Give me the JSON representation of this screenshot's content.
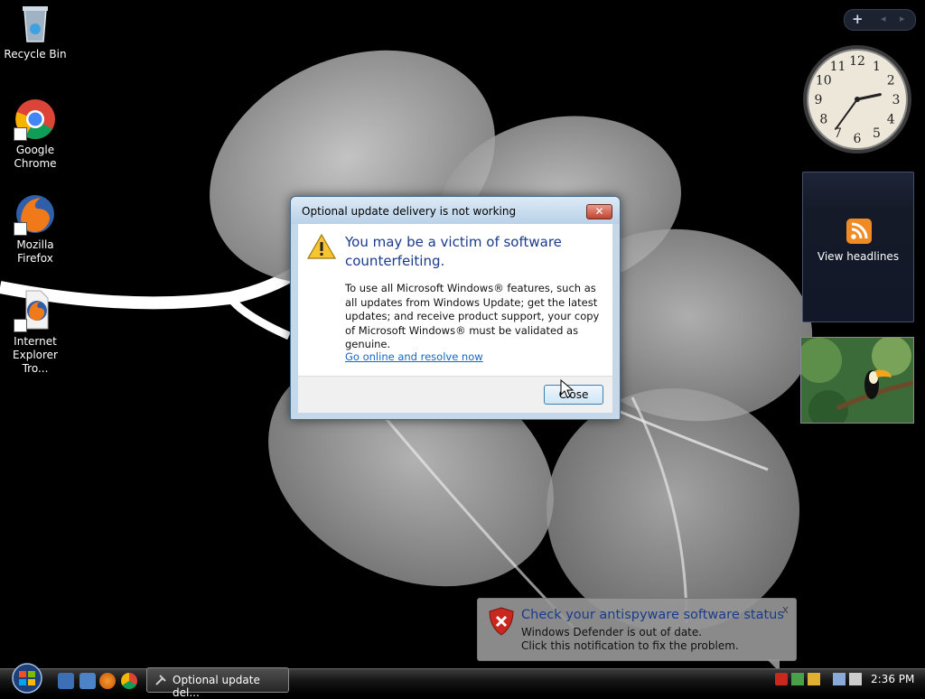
{
  "desktop": {
    "icons": [
      {
        "label": "Recycle Bin"
      },
      {
        "label": "Google Chrome"
      },
      {
        "label": "Mozilla Firefox"
      },
      {
        "label": "Internet Explorer Tro..."
      }
    ]
  },
  "sidebar": {
    "controls": {
      "add": "+",
      "arrows": "◂ ▸"
    },
    "clock": {
      "numbers": [
        "12",
        "1",
        "2",
        "3",
        "4",
        "5",
        "6",
        "7",
        "8",
        "9",
        "10",
        "11"
      ],
      "hour": 2,
      "minute": 36
    },
    "feed": {
      "label": "View headlines"
    }
  },
  "dialog": {
    "title": "Optional update delivery is not working",
    "close_glyph": "✕",
    "heading": "You may be a victim of software counterfeiting.",
    "body": "To use all Microsoft Windows® features, such as all updates from Windows Update; get the latest updates; and receive product support, your copy of Microsoft Windows® must be validated as genuine.",
    "link": "Go online and resolve now",
    "button": "Close"
  },
  "balloon": {
    "title": "Check your antispyware software status",
    "line1": "Windows Defender is out of date.",
    "line2": "Click this notification to fix the problem.",
    "close_glyph": "x"
  },
  "taskbar": {
    "task_label": "Optional update del...",
    "clock": "2:36 PM"
  },
  "colors": {
    "heading": "#1a3b8c",
    "link": "#1467c4",
    "dialog_frame": "#c5d8ea",
    "rss": "#f08a24"
  }
}
